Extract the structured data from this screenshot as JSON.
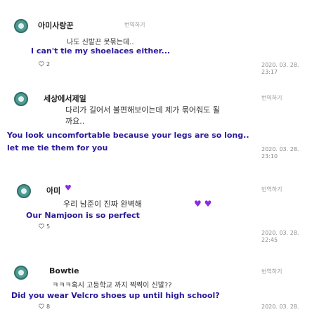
{
  "comments": [
    {
      "username": "아미사랑꾼",
      "translate": "번역하기",
      "korean": [
        "나도 신발끈 못묶는데..",
        ""
      ],
      "english": "I can't tie my shoelaces either...",
      "likes": "2",
      "date": "2020. 03. 28.",
      "time": "23:17"
    },
    {
      "username": "세상에서제일",
      "translate": "번역하기",
      "korean": [
        "다리가 길어서 불편해보이는데 제가 묶어줘도 될",
        "까요.."
      ],
      "english": "You look uncomfortable because your legs are so long..",
      "english2": "let me tie them for you",
      "likes": "",
      "date": "2020. 03. 28.",
      "time": "23:10"
    },
    {
      "username": "아미",
      "translate": "번역하기",
      "korean": [
        "우리 남준이 진짜 완벽해 ",
        ""
      ],
      "english": "Our Namjoon is so perfect",
      "likes": "5",
      "date": "2020. 03. 28.",
      "time": "22:45"
    },
    {
      "username": "Bowtie",
      "translate": "번역하기",
      "korean": [
        "ㅋㅋㅋ혹시 고등학교 까지 찍찍이 신발??"
      ],
      "english": "Did you wear Velcro shoes up until high school?",
      "likes": "8",
      "date": "2020. 03. 28.",
      "time": ""
    }
  ],
  "colors": {
    "avatar": "#4e9a92",
    "english_text": "#2a1a99",
    "heart": "#8a2be2"
  }
}
